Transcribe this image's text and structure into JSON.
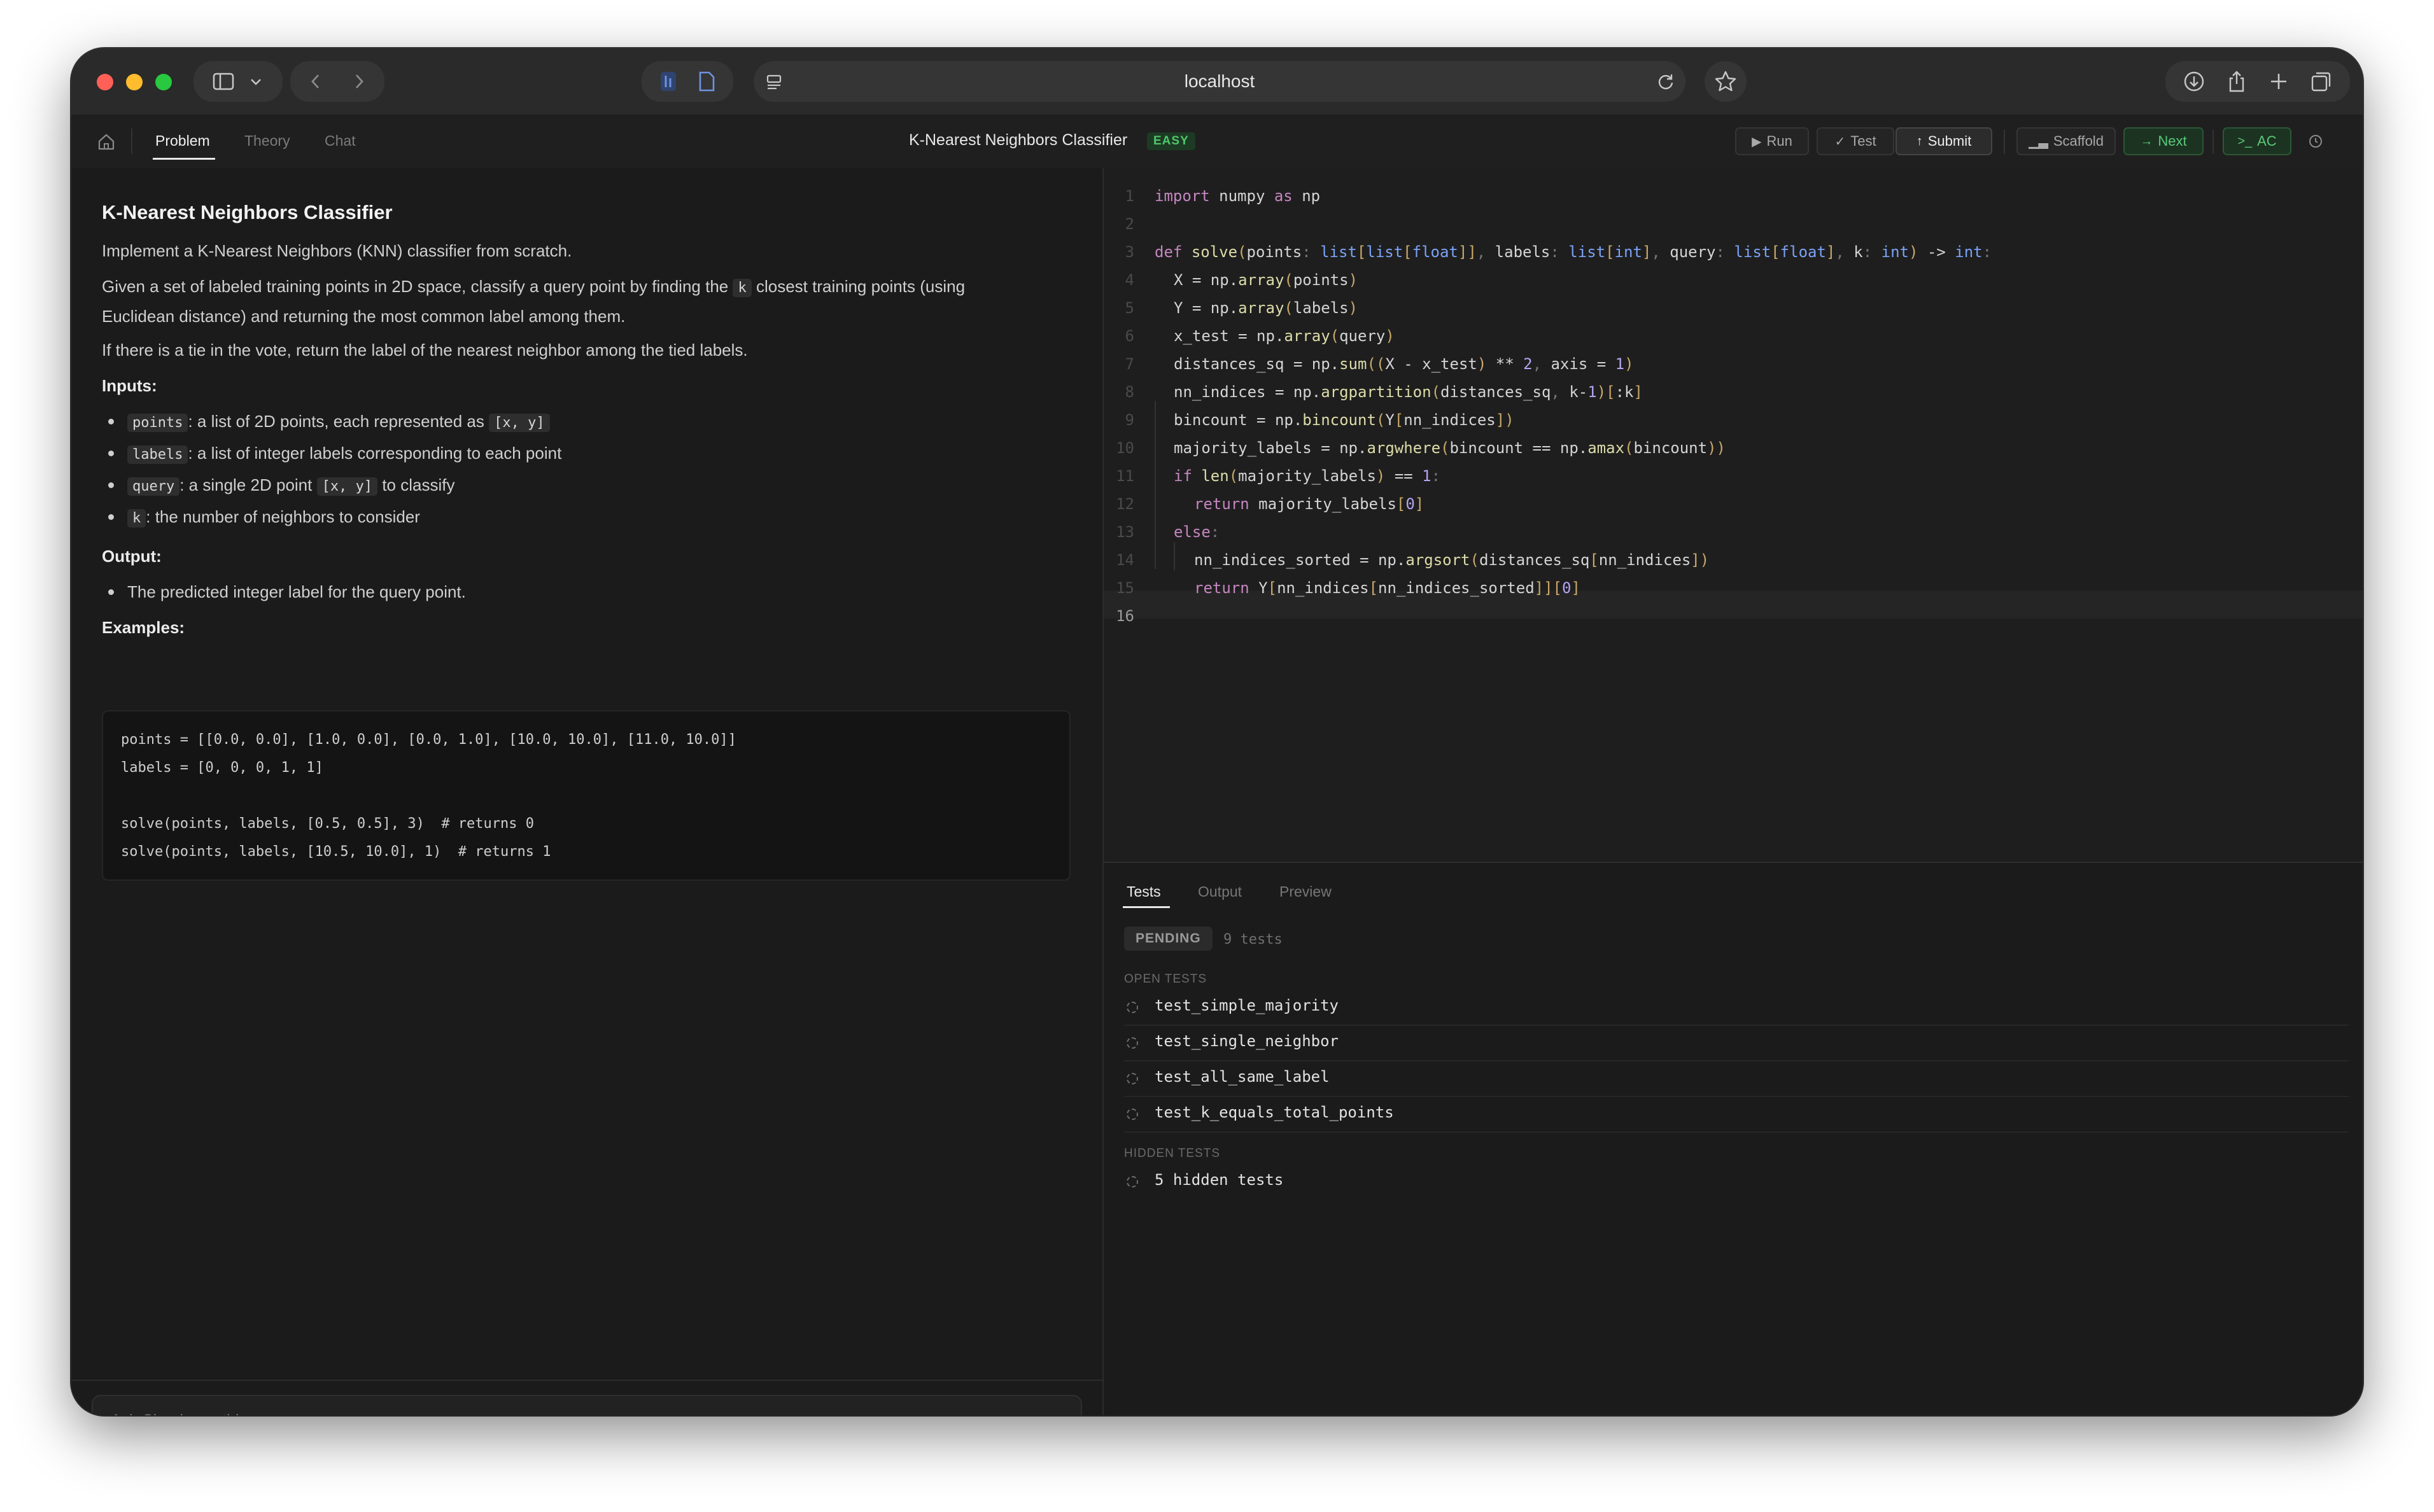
{
  "browser": {
    "url": "localhost",
    "colors": {
      "close": "#fe5f57",
      "minimize": "#febc2e",
      "maximize": "#28c840"
    }
  },
  "appbar": {
    "tabs": [
      "Problem",
      "Theory",
      "Chat"
    ],
    "title": "K-Nearest Neighbors Classifier",
    "difficulty": "EASY",
    "buttons": {
      "run": "Run",
      "test": "Test",
      "submit": "Submit",
      "scaffold": "Scaffold",
      "next": "Next",
      "ac": "AC"
    }
  },
  "problem": {
    "title": "K-Nearest Neighbors Classifier",
    "intro": "Implement a K-Nearest Neighbors (KNN) classifier from scratch.",
    "desc_a": "Given a set of labeled training points in 2D space, classify a query point by finding the",
    "desc_k": "k",
    "desc_b": "closest training points (using",
    "desc_c": "Euclidean distance) and returning the most common label among them.",
    "tie": "If there is a tie in the vote, return the label of the nearest neighbor among the tied labels.",
    "inputs_heading": "Inputs:",
    "inputs": [
      {
        "code": "points",
        "text": ": a list of 2D points, each represented as",
        "code2": "[x, y]",
        "text2": ""
      },
      {
        "code": "labels",
        "text": ": a list of integer labels corresponding to each point",
        "code2": "",
        "text2": ""
      },
      {
        "code": "query",
        "text": ": a single 2D point",
        "code2": "[x, y]",
        "text2": "to classify"
      },
      {
        "code": "k",
        "text": ": the number of neighbors to consider",
        "code2": "",
        "text2": ""
      }
    ],
    "output_heading": "Output:",
    "output": "The predicted integer label for the query point.",
    "examples_heading": "Examples:",
    "example_lines": [
      "points = [[0.0, 0.0], [1.0, 0.0], [0.0, 1.0], [10.0, 10.0], [11.0, 10.0]]",
      "labels = [0, 0, 0, 1, 1]",
      "",
      "solve(points, labels, [0.5, 0.5], 3)  # returns 0",
      "solve(points, labels, [10.5, 10.0], 1)  # returns 1"
    ],
    "ask_placeholder": "Ask Claude anything..."
  },
  "editor": {
    "line_numbers": [
      "1",
      "2",
      "3",
      "4",
      "5",
      "6",
      "7",
      "8",
      "9",
      "10",
      "11",
      "12",
      "13",
      "14",
      "15",
      "16"
    ]
  },
  "panel": {
    "tabs": [
      "Tests",
      "Output",
      "Preview"
    ],
    "status": "PENDING",
    "count": "9 tests",
    "open_heading": "OPEN TESTS",
    "open_tests": [
      "test_simple_majority",
      "test_single_neighbor",
      "test_all_same_label",
      "test_k_equals_total_points"
    ],
    "hidden_heading": "HIDDEN TESTS",
    "hidden_tests": [
      "5 hidden tests"
    ]
  }
}
